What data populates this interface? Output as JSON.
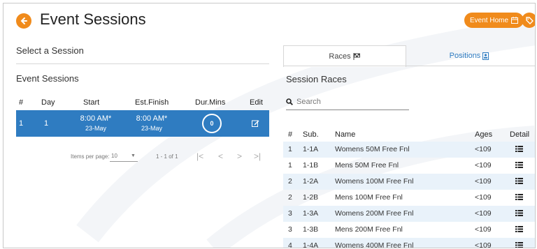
{
  "header": {
    "title": "Event Sessions",
    "event_home_label": "Event Home"
  },
  "left": {
    "select_title": "Select a Session",
    "sessions_title": "Event Sessions",
    "columns": {
      "num": "#",
      "day": "Day",
      "start": "Start",
      "est_finish": "Est.Finish",
      "dur": "Dur.Mins",
      "edit": "Edit"
    },
    "sessions": [
      {
        "num": "1",
        "day": "1",
        "start_time": "8:00 AM*",
        "start_date": "23-May",
        "finish_time": "8:00 AM*",
        "finish_date": "23-May",
        "dur": "0"
      }
    ],
    "paginator": {
      "items_label": "Items per page:",
      "page_size": "10",
      "range": "1 - 1 of 1"
    }
  },
  "right": {
    "tabs": [
      {
        "label": "Races"
      },
      {
        "label": "Positions"
      }
    ],
    "title": "Session Races",
    "search_placeholder": "Search",
    "columns": {
      "num": "#",
      "sub": "Sub.",
      "name": "Name",
      "ages": "Ages",
      "detail": "Detail"
    },
    "races": [
      {
        "num": "1",
        "sub": "1-1A",
        "name": "Womens 50M Free Fnl",
        "ages": "<109"
      },
      {
        "num": "1",
        "sub": "1-1B",
        "name": "Mens 50M Free Fnl",
        "ages": "<109"
      },
      {
        "num": "2",
        "sub": "1-2A",
        "name": "Womens 100M Free Fnl",
        "ages": "<109"
      },
      {
        "num": "2",
        "sub": "1-2B",
        "name": "Mens 100M Free Fnl",
        "ages": "<109"
      },
      {
        "num": "3",
        "sub": "1-3A",
        "name": "Womens 200M Free Fnl",
        "ages": "<109"
      },
      {
        "num": "3",
        "sub": "1-3B",
        "name": "Mens 200M Free Fnl",
        "ages": "<109"
      },
      {
        "num": "4",
        "sub": "1-4A",
        "name": "Womens 400M Free Fnl",
        "ages": "<109"
      }
    ]
  },
  "colors": {
    "accent": "#f08b1c",
    "selected": "#2f7cc1",
    "row_alt": "#e9f2fa"
  }
}
